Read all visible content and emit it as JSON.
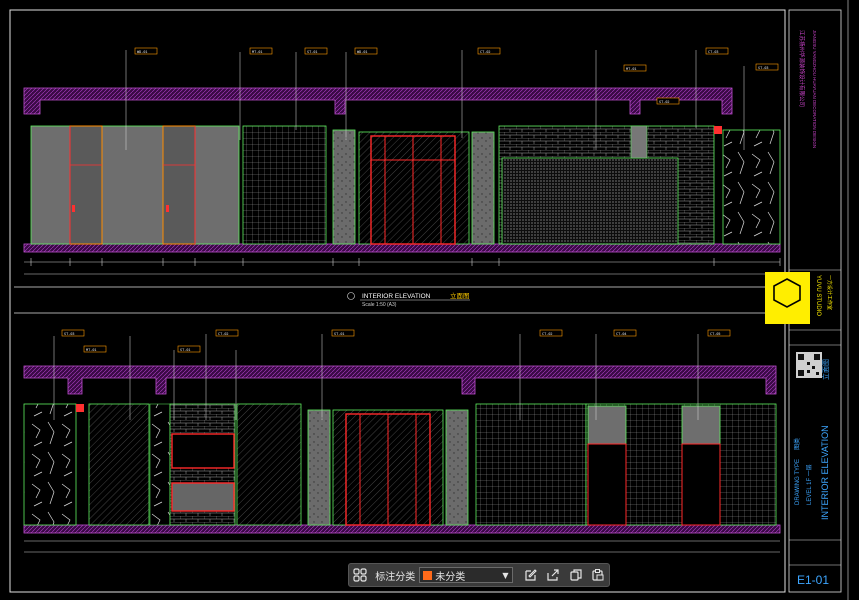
{
  "drawing": {
    "upper_title": "INTERIOR ELEVATION",
    "upper_title_cn": "立面图",
    "upper_scale": "Scale 1:50 (A3)",
    "sheet_number": "E1-01",
    "drawing_type_label": "DRAWING TYPE",
    "drawing_type_cn": "图类",
    "level_label": "LEVEL 1F 一层",
    "vertical_title": "INTERIOR ELEVATION",
    "vertical_title_cn": "立面图",
    "firm_cn": "江苏扬州华源装饰设计有限公司",
    "firm_en": "JIANGSU YANGZHOU HUAYUAN DECORATION DESIGN",
    "studio_name": "YUVU STUDIO",
    "studio_name_cn": "一方设计工作室",
    "callouts_upper": [
      "WD-01",
      "MT-01",
      "ST-01",
      "WD-01",
      "CT-02",
      "CT-03",
      "MT-01",
      "ST-03",
      "ST-02"
    ],
    "callouts_lower": [
      "ST-03",
      "MT-01",
      "ST-01",
      "CT-02",
      "ST-01",
      "CT-02",
      "CT-04",
      "CT-05"
    ]
  },
  "toolbar": {
    "category_label": "标注分类",
    "category_value": "未分类",
    "category_color": "#ff6a1a"
  },
  "icons": {
    "grid": "grid-icon",
    "edit": "edit-icon",
    "export": "export-icon",
    "copy": "copy-icon",
    "paste": "paste-icon"
  }
}
